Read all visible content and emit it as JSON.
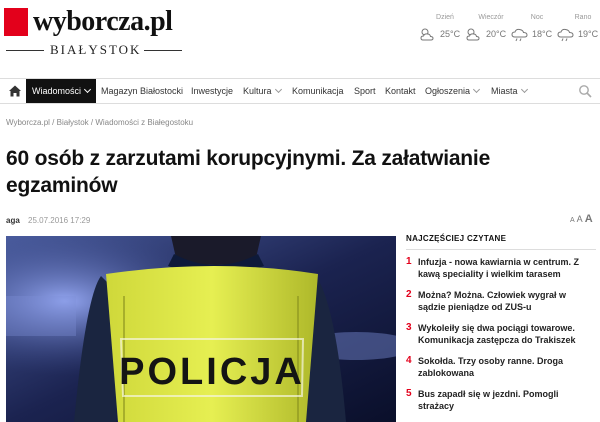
{
  "header": {
    "logo_text": "wyborcza.pl",
    "city": "BIAŁYSTOK",
    "brand_color": "#e3001b"
  },
  "weather": [
    {
      "label": "Dzień",
      "temp": "25°C",
      "icon": "partly-cloudy-icon"
    },
    {
      "label": "Wieczór",
      "temp": "20°C",
      "icon": "partly-cloudy-icon"
    },
    {
      "label": "Noc",
      "temp": "18°C",
      "icon": "cloud-rain-icon"
    },
    {
      "label": "Rano",
      "temp": "19°C",
      "icon": "cloud-rain-icon"
    }
  ],
  "nav": {
    "items": [
      {
        "label": "Wiadomości",
        "active": true,
        "dropdown": true
      },
      {
        "label": "Magazyn Białostocki",
        "active": false,
        "dropdown": false
      },
      {
        "label": "Inwestycje",
        "active": false,
        "dropdown": false
      },
      {
        "label": "Kultura",
        "active": false,
        "dropdown": true
      },
      {
        "label": "Komunikacja",
        "active": false,
        "dropdown": false
      },
      {
        "label": "Sport",
        "active": false,
        "dropdown": false
      },
      {
        "label": "Kontakt",
        "active": false,
        "dropdown": false
      },
      {
        "label": "Ogłoszenia",
        "active": false,
        "dropdown": true
      },
      {
        "label": "Miasta",
        "active": false,
        "dropdown": true
      }
    ]
  },
  "breadcrumb": [
    "Wyborcza.pl",
    "Białystok",
    "Wiadomości z Białegostoku"
  ],
  "article": {
    "title": "60 osób z zarzutami korupcyjnymi. Za załatwianie egzaminów",
    "author": "aga",
    "date": "25.07.2016 17:29",
    "font_controls": [
      "A",
      "A",
      "A"
    ],
    "photo_text": "POLICJA"
  },
  "sidebar": {
    "title": "NAJCZĘŚCIEJ CZYTANE",
    "items": [
      {
        "num": "1",
        "text": "Infuzja - nowa kawiarnia w centrum. Z kawą speciality i wielkim tarasem"
      },
      {
        "num": "2",
        "text": "Można? Można. Człowiek wygrał w sądzie pieniądze od ZUS-u"
      },
      {
        "num": "3",
        "text": "Wykoleiły się dwa pociągi towarowe. Komunikacja zastępcza do Trakiszek"
      },
      {
        "num": "4",
        "text": "Sokołda. Trzy osoby ranne. Droga zablokowana"
      },
      {
        "num": "5",
        "text": "Bus zapadł się w jezdni. Pomogli strażacy"
      }
    ]
  }
}
